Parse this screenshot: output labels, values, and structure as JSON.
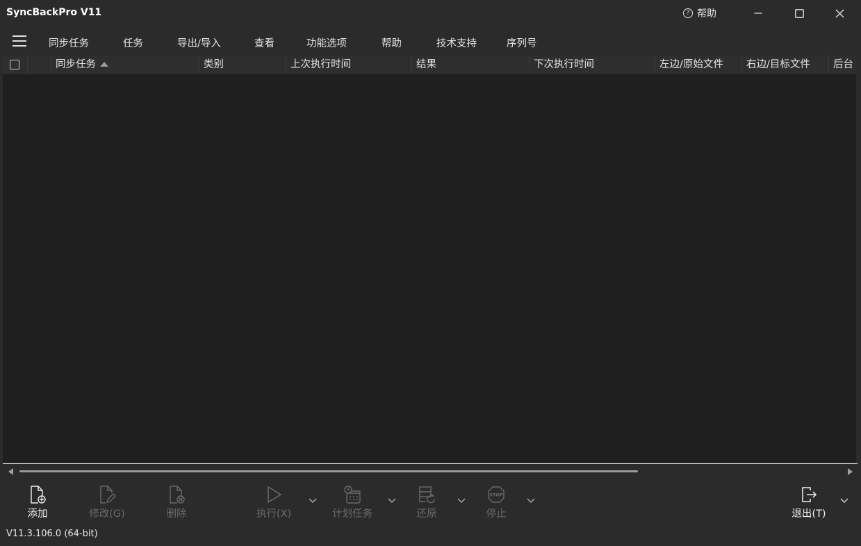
{
  "window": {
    "title": "SyncBackPro V11",
    "help_label": "帮助",
    "help_icon": "?"
  },
  "menu": {
    "items": [
      "同步任务",
      "任务",
      "导出/导入",
      "查看",
      "功能选项",
      "帮助",
      "技术支持",
      "序列号"
    ]
  },
  "list": {
    "columns": [
      "同步任务",
      "类别",
      "上次执行时间",
      "结果",
      "下次执行时间",
      "左边/原始文件",
      "右边/目标文件",
      "后台"
    ],
    "sorted_column": "同步任务",
    "sort_direction": "ascending",
    "rows": []
  },
  "toolbar": {
    "add": "添加",
    "modify": "修改(G)",
    "delete": "删除",
    "run": "执行(X)",
    "schedule": "计划任务",
    "restore": "还原",
    "stop": "停止",
    "exit": "退出(T)"
  },
  "status": {
    "version": "V11.3.106.0 (64-bit)"
  },
  "colors": {
    "background": "#2b2b2b",
    "list_background": "#1f1f1f",
    "text": "#e6e6e6",
    "disabled_text": "#6a6a6a"
  }
}
